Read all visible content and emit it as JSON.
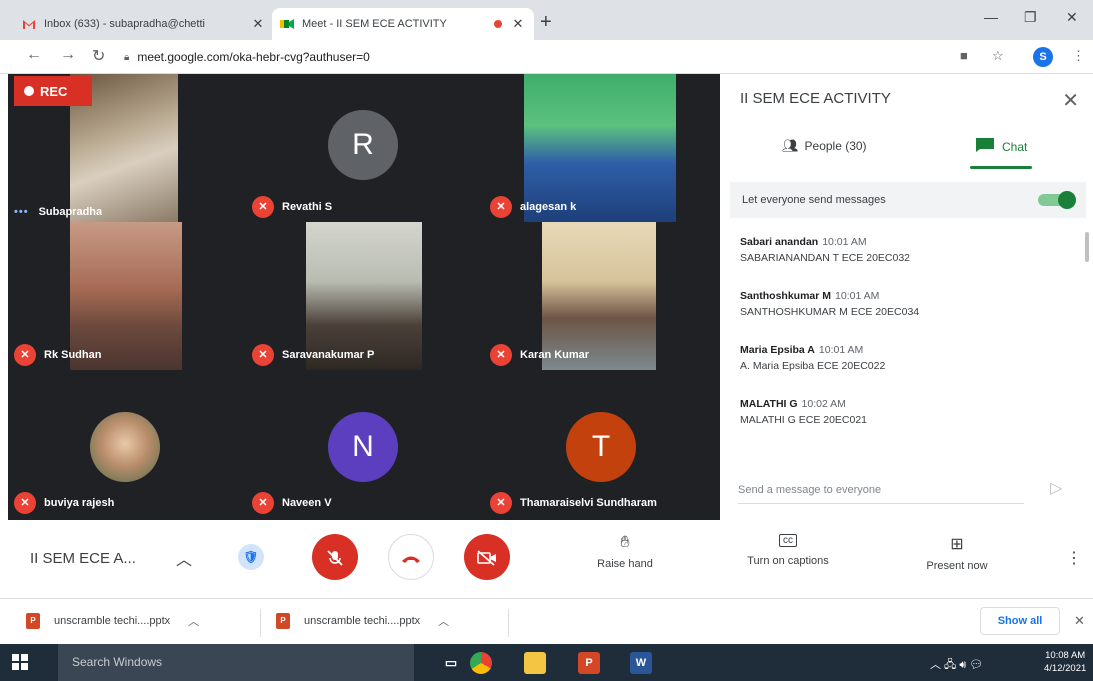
{
  "browser": {
    "tabs": [
      {
        "title": "Inbox (633) - subapradha@chetti",
        "favicon": "gmail-icon",
        "active": false
      },
      {
        "title": "Meet - II SEM ECE ACTIVITY",
        "favicon": "meet-icon",
        "active": true,
        "recording": true
      }
    ],
    "url": "meet.google.com/oka-hebr-cvg?authuser=0",
    "profile_initial": "S"
  },
  "meet": {
    "rec_label": "REC",
    "participants": [
      {
        "name": "Subapradha",
        "type": "video",
        "muted": false,
        "speaking": true
      },
      {
        "name": "Revathi S",
        "type": "avatar",
        "initial": "R",
        "color": "#5f6368",
        "muted": true
      },
      {
        "name": "alagesan k",
        "type": "video",
        "muted": true
      },
      {
        "name": "Rk Sudhan",
        "type": "video",
        "muted": true
      },
      {
        "name": "Saravanakumar P",
        "type": "video",
        "muted": true
      },
      {
        "name": "Karan Kumar",
        "type": "video",
        "muted": true
      },
      {
        "name": "buviya rajesh",
        "type": "photo",
        "muted": true
      },
      {
        "name": "Naveen V",
        "type": "avatar",
        "initial": "N",
        "color": "#5b3fbf",
        "muted": true
      },
      {
        "name": "Thamaraiselvi Sundharam",
        "type": "avatar",
        "initial": "T",
        "color": "#c2410c",
        "muted": true
      }
    ]
  },
  "panel": {
    "title": "II SEM ECE ACTIVITY",
    "people_tab": "People (30)",
    "chat_tab": "Chat",
    "send_toggle_label": "Let everyone send messages",
    "messages": [
      {
        "sender": "Sabari anandan",
        "time": "10:01 AM",
        "text": "SABARIANANDAN T ECE 20EC032"
      },
      {
        "sender": "Santhoshkumar M",
        "time": "10:01 AM",
        "text": "SANTHOSHKUMAR M ECE 20EC034"
      },
      {
        "sender": "Maria Epsiba A",
        "time": "10:01 AM",
        "text": "A. Maria Epsiba ECE 20EC022"
      },
      {
        "sender": "MALATHI G",
        "time": "10:02 AM",
        "text": "MALATHI G ECE 20EC021"
      }
    ],
    "compose_placeholder": "Send a message to everyone"
  },
  "controls": {
    "meeting_name": "II SEM ECE A...",
    "raise_hand": "Raise hand",
    "captions": "Turn on captions",
    "present": "Present now"
  },
  "downloads": {
    "files": [
      "unscramble techi....pptx",
      "unscramble techi....pptx"
    ],
    "show_all": "Show all"
  },
  "taskbar": {
    "search_placeholder": "Search Windows",
    "time": "10:08 AM",
    "date": "4/12/2021"
  }
}
